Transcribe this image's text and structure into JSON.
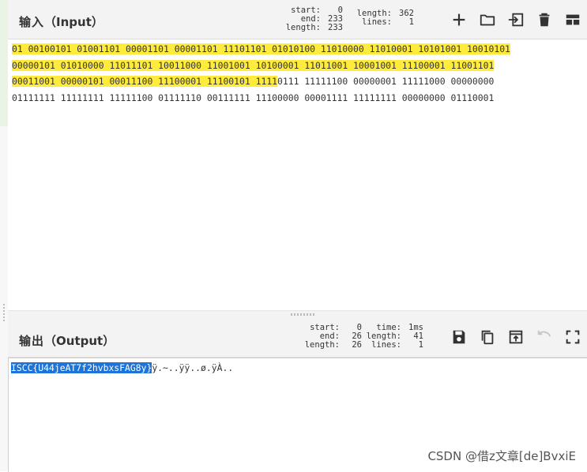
{
  "input": {
    "title_zh": "输入",
    "title_en": "（Input）",
    "stats_left": [
      [
        "start:",
        "0"
      ],
      [
        "end:",
        "233"
      ],
      [
        "length:",
        "233"
      ]
    ],
    "stats_right": [
      [
        "length:",
        "362"
      ],
      [
        "lines:",
        "1"
      ]
    ],
    "lines": [
      {
        "hl": "01 00100101 01001101 00001101 00001101 11101101 01010100 11010000 11010001 10101001 10010101",
        "rest": ""
      },
      {
        "hl": "00000101 01010000 11011101 10011000 11001001 10100001 11011001 10001001 11100001 11001101",
        "rest": ""
      },
      {
        "hl": "00011001 00000101 00011100 11100001 11100101 1111",
        "rest": "0111 11111100 00000001 11111000 00000000"
      },
      {
        "hl": "",
        "rest": "01111111 11111111 11111100 01111110 00111111 11100000 00001111 11111111 00000000 01110001"
      }
    ]
  },
  "output": {
    "title_zh": "输出",
    "title_en": "（Output）",
    "stats_left": [
      [
        "start:",
        "0"
      ],
      [
        "end:",
        "26"
      ],
      [
        "length:",
        "26"
      ]
    ],
    "stats_right": [
      [
        "time:",
        "1ms"
      ],
      [
        "length:",
        "41"
      ],
      [
        "lines:",
        "1"
      ]
    ],
    "selected_text": "ISCC{U44jeAT7f2hvbxsFAG8y}",
    "rest_text": "ÿ.~..ÿÿ..ø.ÿÀ.."
  },
  "watermark": "CSDN @借z文章[de]BvxiE"
}
